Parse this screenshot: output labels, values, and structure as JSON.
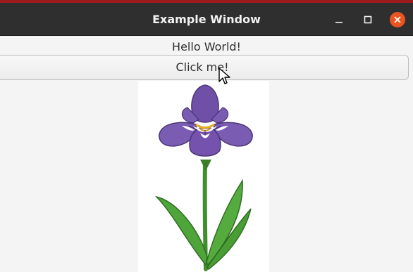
{
  "window": {
    "title": "Example Window",
    "controls": {
      "minimize_icon": "minimize-icon",
      "maximize_icon": "maximize-icon",
      "close_icon": "close-icon"
    },
    "accent_color": "#9e1a1f",
    "close_color": "#e95420"
  },
  "content": {
    "label_text": "Hello World!",
    "button_label": "Click me!",
    "image": {
      "subject": "iris-flower",
      "icon": "iris-flower-image"
    }
  },
  "cursor": {
    "icon": "mouse-pointer-icon"
  }
}
